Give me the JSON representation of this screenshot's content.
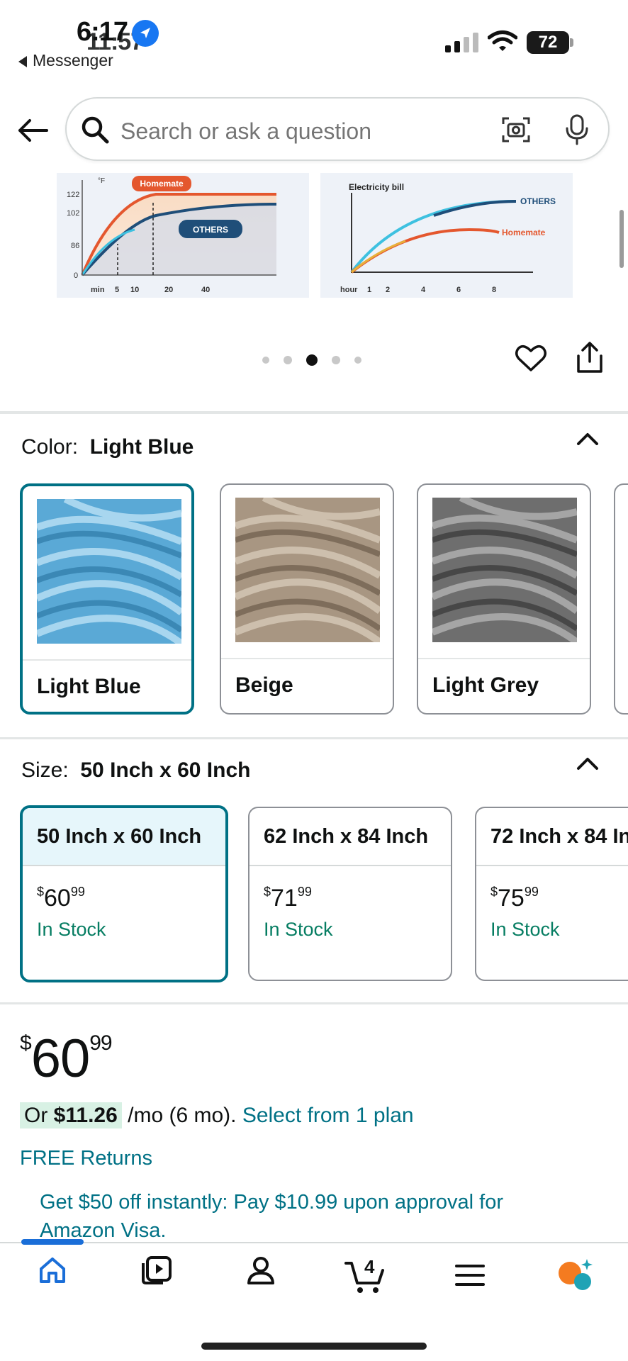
{
  "status_bar": {
    "time_primary": "6:17",
    "time_secondary": "11:57",
    "back_app": "Messenger",
    "battery": "72"
  },
  "search": {
    "placeholder": "Search or ask a question"
  },
  "charts": [
    {
      "type": "line",
      "y_unit": "°F",
      "badge_label": "Homemate",
      "series_label": "OTHERS",
      "y_ticks": [
        "122",
        "102",
        "86",
        "0"
      ],
      "x_ticks": [
        "min",
        "5",
        "10",
        "20",
        "40"
      ],
      "series": [
        {
          "name": "Homemate",
          "color": "#e4572e"
        },
        {
          "name": "OTHERS",
          "color": "#1f4e79"
        }
      ]
    },
    {
      "type": "line",
      "title": "Electricity bill",
      "x_ticks": [
        "hour",
        "1",
        "2",
        "4",
        "6",
        "8"
      ],
      "series": [
        {
          "name": "OTHERS",
          "color": "#1f4e79"
        },
        {
          "name": "Homemate",
          "color": "#e4572e"
        }
      ]
    }
  ],
  "carousel": {
    "total": 5,
    "active_index": 2
  },
  "color": {
    "label": "Color:",
    "selected": "Light Blue",
    "options": [
      {
        "name": "Light Blue",
        "swatch": "#5aa9d6"
      },
      {
        "name": "Beige",
        "swatch": "#a89682"
      },
      {
        "name": "Light Grey",
        "swatch": "#6e6e6e"
      }
    ]
  },
  "size": {
    "label": "Size:",
    "selected": "50 Inch x 60 Inch",
    "options": [
      {
        "name": "50 Inch x 60 Inch",
        "currency": "$",
        "whole": "60",
        "cents": "99",
        "stock": "In Stock"
      },
      {
        "name": "62 Inch x 84 Inch",
        "currency": "$",
        "whole": "71",
        "cents": "99",
        "stock": "In Stock"
      },
      {
        "name": "72 Inch x 84 In",
        "currency": "$",
        "whole": "75",
        "cents": "99",
        "stock": "In Stock"
      }
    ]
  },
  "price": {
    "currency": "$",
    "whole": "60",
    "cents": "99",
    "monthly_prefix": "Or ",
    "monthly_amount": "$11.26",
    "monthly_suffix": " /mo (6 mo). ",
    "plan_link": "Select from 1 plan",
    "free_returns": "FREE Returns",
    "visa_offer": "Get $50 off instantly: Pay $10.99 upon approval for Amazon Visa."
  },
  "nav": {
    "cart_count": "4",
    "items": [
      "home-icon",
      "video-icon",
      "account-icon",
      "cart-icon",
      "menu-icon",
      "rufus-icon"
    ]
  },
  "colors": {
    "link": "#007185",
    "selected_border": "#007185",
    "in_stock": "#067d62",
    "nav_active": "#1a6ed8"
  }
}
